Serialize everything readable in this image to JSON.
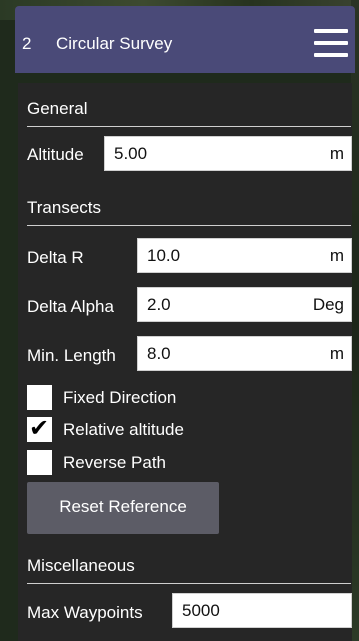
{
  "header": {
    "index": "2",
    "title": "Circular Survey",
    "menu_icon": "hamburger-menu-icon"
  },
  "general": {
    "section_label": "General",
    "altitude": {
      "label": "Altitude",
      "value": "5.00",
      "unit": "m"
    }
  },
  "transects": {
    "section_label": "Transects",
    "delta_r": {
      "label": "Delta R",
      "value": "10.0",
      "unit": "m"
    },
    "delta_alpha": {
      "label": "Delta Alpha",
      "value": "2.0",
      "unit": "Deg"
    },
    "min_length": {
      "label": "Min. Length",
      "value": "8.0",
      "unit": "m"
    },
    "fixed_direction": {
      "label": "Fixed Direction",
      "checked": false
    },
    "relative_altitude": {
      "label": "Relative altitude",
      "checked": true
    },
    "reverse_path": {
      "label": "Reverse Path",
      "checked": false
    },
    "reset_button": "Reset Reference"
  },
  "miscellaneous": {
    "section_label": "Miscellaneous",
    "max_waypoints": {
      "label": "Max Waypoints",
      "value": "5000"
    }
  },
  "colors": {
    "title_bar": "#4a4a78",
    "panel_bg": "#262626",
    "button_bg": "#5c5c66"
  }
}
